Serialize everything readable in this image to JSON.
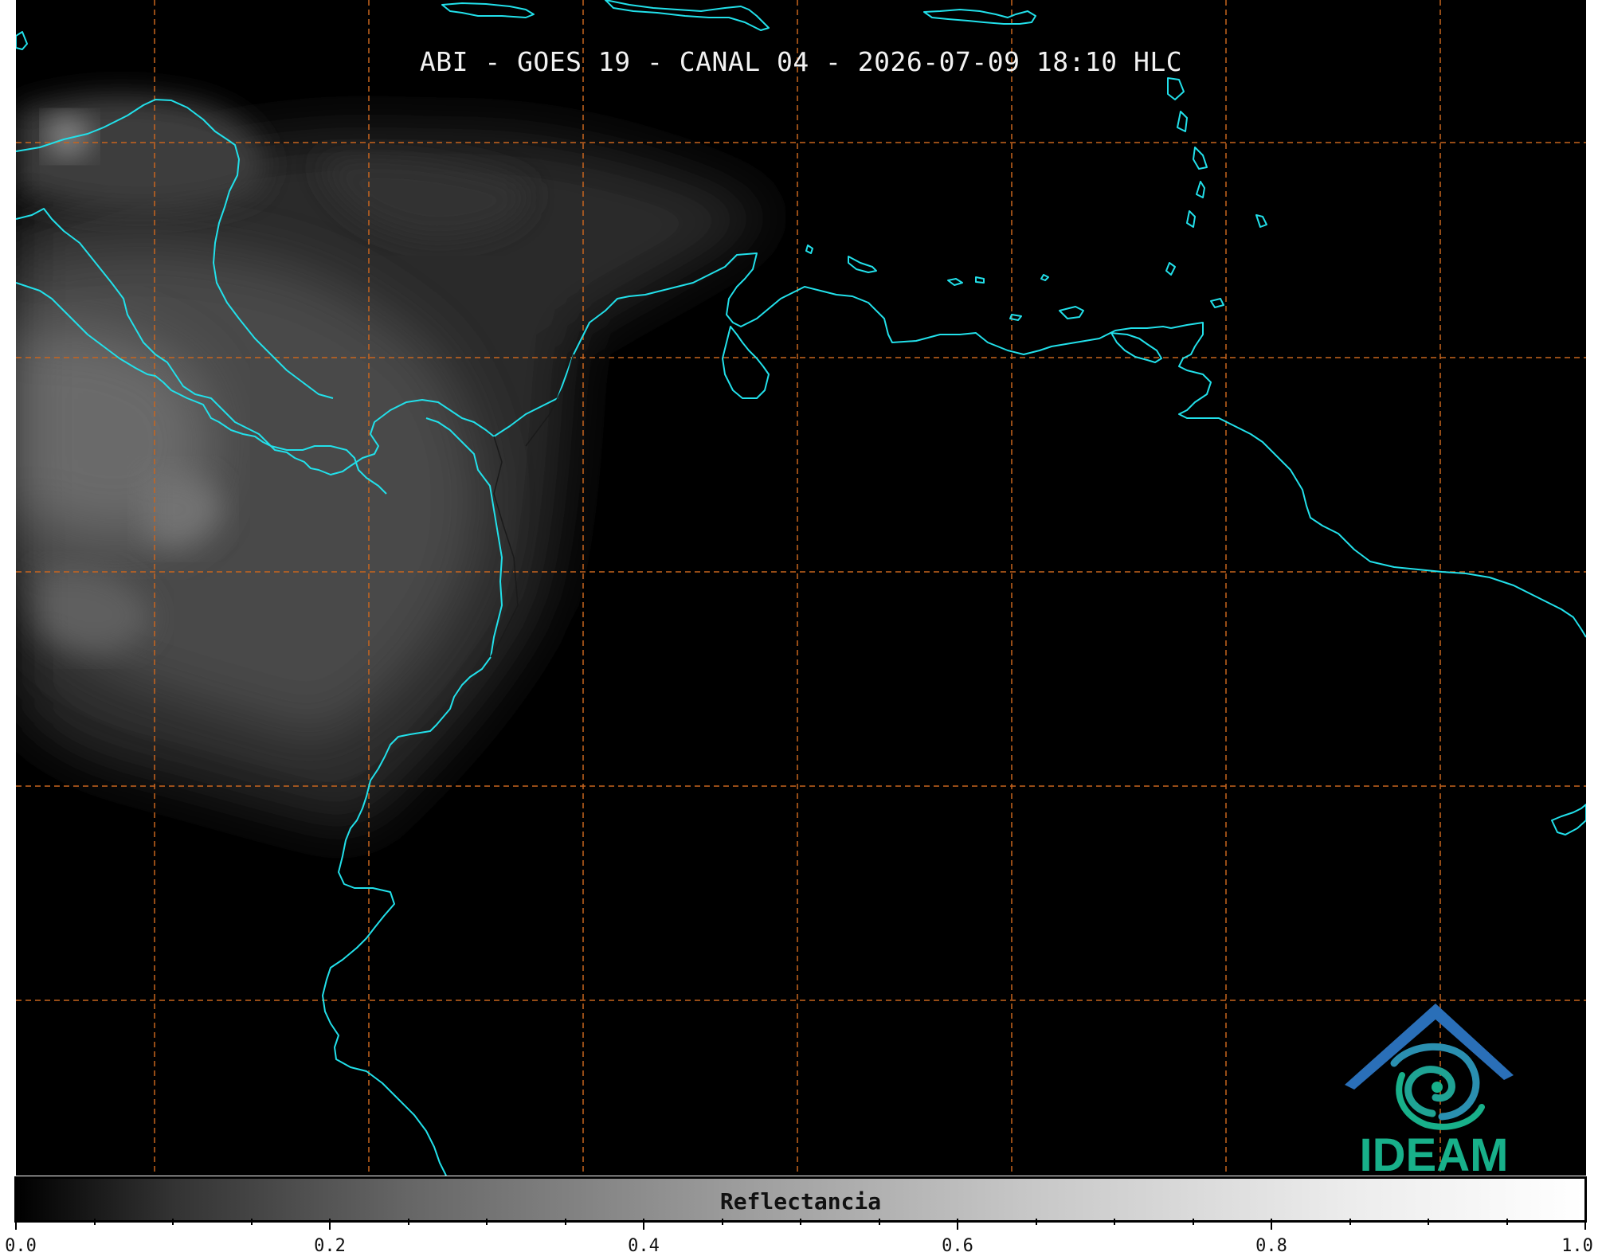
{
  "title": "ABI - GOES 19 - CANAL 04 - 2026-07-09 18:10 HLC",
  "colorbar": {
    "label": "Reflectancia",
    "ticks": [
      "0.0",
      "0.2",
      "0.4",
      "0.6",
      "0.8",
      "1.0"
    ],
    "range": [
      0.0,
      1.0
    ]
  },
  "logo": {
    "text": "IDEAM"
  },
  "colors": {
    "coastline": "#22e0ea",
    "gridline": "#c8651e",
    "logo_blue": "#2a6fb8",
    "logo_teal": "#18b08a"
  }
}
